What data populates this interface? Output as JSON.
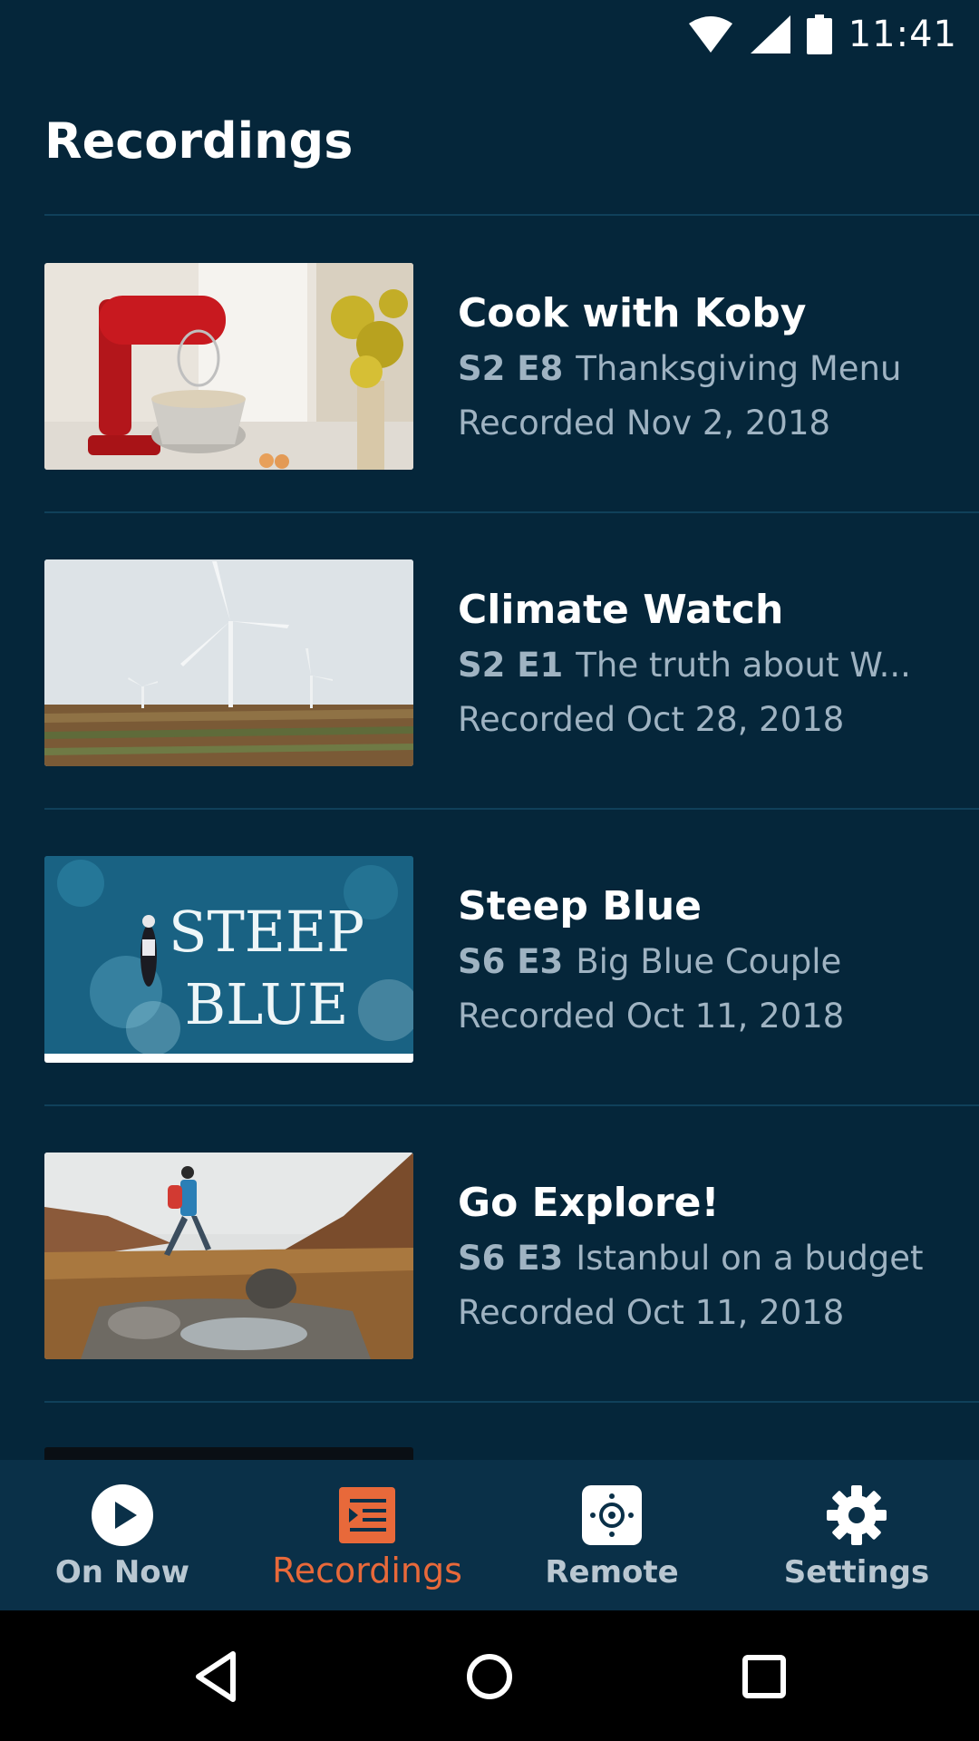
{
  "status_bar": {
    "time": "11:41",
    "icons": [
      "wifi-icon",
      "signal-icon",
      "battery-icon"
    ]
  },
  "page": {
    "title": "Recordings"
  },
  "recordings": [
    {
      "title": "Cook with Koby",
      "episode": "S2 E8",
      "episode_title": "Thanksgiving Menu",
      "recorded": "Recorded Nov 2, 2018"
    },
    {
      "title": "Climate Watch",
      "episode": "S2 E1",
      "episode_title": "The truth about W...",
      "recorded": "Recorded Oct 28, 2018"
    },
    {
      "title": "Steep Blue",
      "episode": "S6 E3",
      "episode_title": "Big Blue Couple",
      "recorded": "Recorded Oct 11, 2018",
      "thumb_text": [
        "STEEP",
        "BLUE"
      ]
    },
    {
      "title": "Go Explore!",
      "episode": "S6 E3",
      "episode_title": "Istanbul on a budget",
      "recorded": "Recorded Oct 11, 2018"
    }
  ],
  "bottom_nav": {
    "items": [
      {
        "label": "On Now",
        "icon": "play-circle-icon"
      },
      {
        "label": "Recordings",
        "icon": "recordings-icon",
        "active": true
      },
      {
        "label": "Remote",
        "icon": "remote-icon"
      },
      {
        "label": "Settings",
        "icon": "gear-icon"
      }
    ]
  },
  "colors": {
    "background": "#05263a",
    "accent": "#e8693a",
    "nav_background": "#0a3048",
    "secondary_text": "#9fb3c2"
  }
}
